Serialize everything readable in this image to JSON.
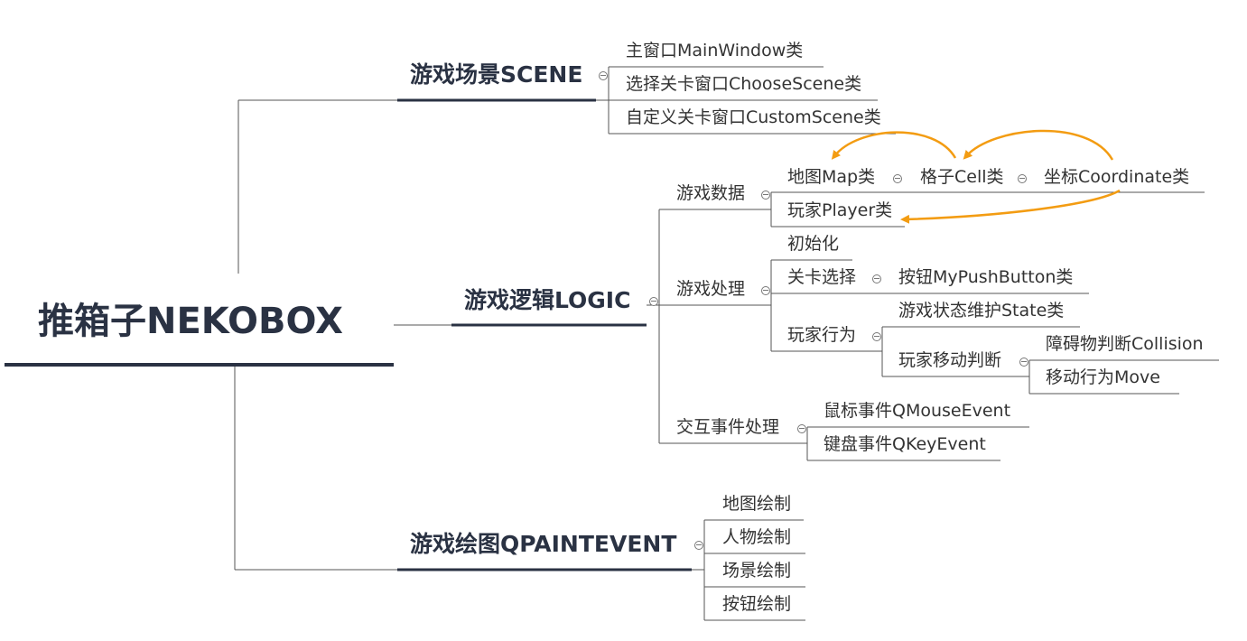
{
  "mindmap": {
    "root": "推箱子NEKOBOX",
    "scene": {
      "label": "游戏场景SCENE",
      "items": [
        "主窗口MainWindow类",
        "选择关卡窗口ChooseScene类",
        "自定义关卡窗口CustomScene类"
      ]
    },
    "logic": {
      "label": "游戏逻辑LOGIC",
      "data": {
        "label": "游戏数据",
        "map": "地图Map类",
        "cell": "格子Cell类",
        "coordinate": "坐标Coordinate类",
        "player": "玩家Player类"
      },
      "process": {
        "label": "游戏处理",
        "init": "初始化",
        "level_select": "关卡选择",
        "button": "按钮MyPushButton类",
        "player_action": "玩家行为",
        "state": "游戏状态维护State类",
        "move_judge": "玩家移动判断",
        "collision": "障碍物判断Collision",
        "move": "移动行为Move"
      },
      "events": {
        "label": "交互事件处理",
        "mouse": "鼠标事件QMouseEvent",
        "key": "键盘事件QKeyEvent"
      }
    },
    "paint": {
      "label": "游戏绘图QPAINTEVENT",
      "items": [
        "地图绘制",
        "人物绘制",
        "场景绘制",
        "按钮绘制"
      ]
    }
  },
  "colors": {
    "dark": "#2a3243",
    "line": "#555555",
    "relation": "#f39c12"
  }
}
